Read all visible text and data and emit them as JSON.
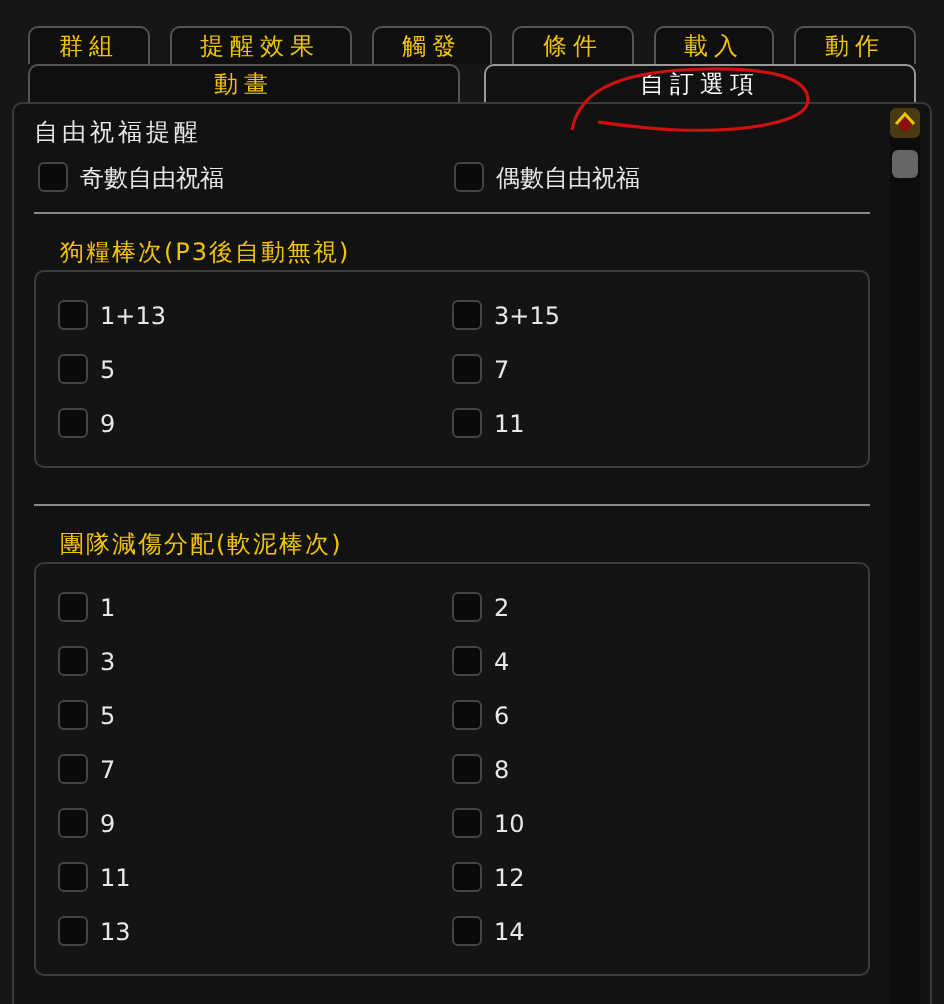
{
  "tab_rows": [
    [
      {
        "label": "群組",
        "selected": false
      },
      {
        "label": "提醒效果",
        "selected": false
      },
      {
        "label": "觸發",
        "selected": false
      },
      {
        "label": "條件",
        "selected": false
      },
      {
        "label": "載入",
        "selected": false
      },
      {
        "label": "動作",
        "selected": false
      }
    ],
    [
      {
        "label": "動畫",
        "selected": false
      },
      {
        "label": "自訂選項",
        "selected": true
      }
    ]
  ],
  "top_option": {
    "title": "自由祝福提醒",
    "checkboxes": [
      {
        "label": "奇數自由祝福",
        "checked": false
      },
      {
        "label": "偶數自由祝福",
        "checked": false
      }
    ]
  },
  "sections": [
    {
      "title": "狗糧棒次(P3後自動無視)",
      "checkboxes": [
        {
          "label": "1+13",
          "checked": false
        },
        {
          "label": "3+15",
          "checked": false
        },
        {
          "label": "5",
          "checked": false
        },
        {
          "label": "7",
          "checked": false
        },
        {
          "label": "9",
          "checked": false
        },
        {
          "label": "11",
          "checked": false
        }
      ]
    },
    {
      "title": "團隊減傷分配(軟泥棒次)",
      "checkboxes": [
        {
          "label": "1",
          "checked": false
        },
        {
          "label": "2",
          "checked": false
        },
        {
          "label": "3",
          "checked": false
        },
        {
          "label": "4",
          "checked": false
        },
        {
          "label": "5",
          "checked": false
        },
        {
          "label": "6",
          "checked": false
        },
        {
          "label": "7",
          "checked": false
        },
        {
          "label": "8",
          "checked": false
        },
        {
          "label": "9",
          "checked": false
        },
        {
          "label": "10",
          "checked": false
        },
        {
          "label": "11",
          "checked": false
        },
        {
          "label": "12",
          "checked": false
        },
        {
          "label": "13",
          "checked": false
        },
        {
          "label": "14",
          "checked": false
        }
      ]
    }
  ]
}
